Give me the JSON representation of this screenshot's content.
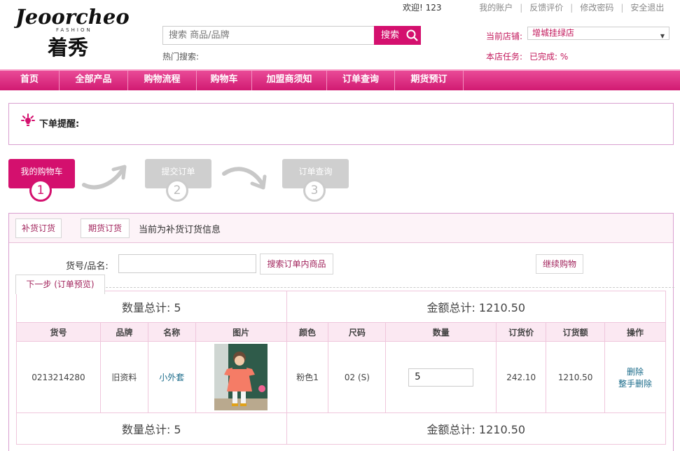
{
  "brand": {
    "name": "Jeoorcheo",
    "sub": "FASHION",
    "cn": "着秀"
  },
  "top_links": {
    "welcome": "欢迎! 123",
    "my_account": "我的账户",
    "feedback": "反馈评价",
    "change_password": "修改密码",
    "logout": "安全退出"
  },
  "search": {
    "placeholder": "搜索 商品/品牌",
    "button": "搜索",
    "hot_label": "热门搜索:"
  },
  "store": {
    "label": "当前店铺:",
    "selected": "增城挂绿店"
  },
  "task": {
    "label": "本店任务:",
    "value": "已完成: %"
  },
  "nav": [
    "首页",
    "全部产品",
    "购物流程",
    "购物车",
    "加盟商须知",
    "订单查询",
    "期货预订"
  ],
  "notice": {
    "title": "下单提醒:"
  },
  "steps": [
    {
      "label": "我的购物车",
      "num": "1"
    },
    {
      "label": "提交订单",
      "num": "2"
    },
    {
      "label": "订单查询",
      "num": "3"
    }
  ],
  "tabs": {
    "restock": "补货订货",
    "futures": "期货订货",
    "info": "当前为补货订货信息"
  },
  "filter": {
    "label": "货号/品名:",
    "search_button": "搜索订单内商品",
    "continue_button": "继续购物",
    "next_button": "下一步 (订单预览)"
  },
  "summary": {
    "qty_text": "数量总计: 5",
    "amount_text": "金额总计: 1210.50"
  },
  "columns": [
    "货号",
    "品牌",
    "名称",
    "图片",
    "颜色",
    "尺码",
    "数量",
    "订货价",
    "订货额",
    "操作"
  ],
  "item": {
    "sku": "0213214280",
    "brand": "旧资料",
    "name": "小外套",
    "color": "粉色1",
    "size": "02 (S)",
    "qty": "5",
    "price": "242.10",
    "amount": "1210.50",
    "delete": "删除",
    "delete_all": "整手删除"
  },
  "colors": {
    "accent": "#d4106e",
    "border": "#d9a0d0"
  }
}
